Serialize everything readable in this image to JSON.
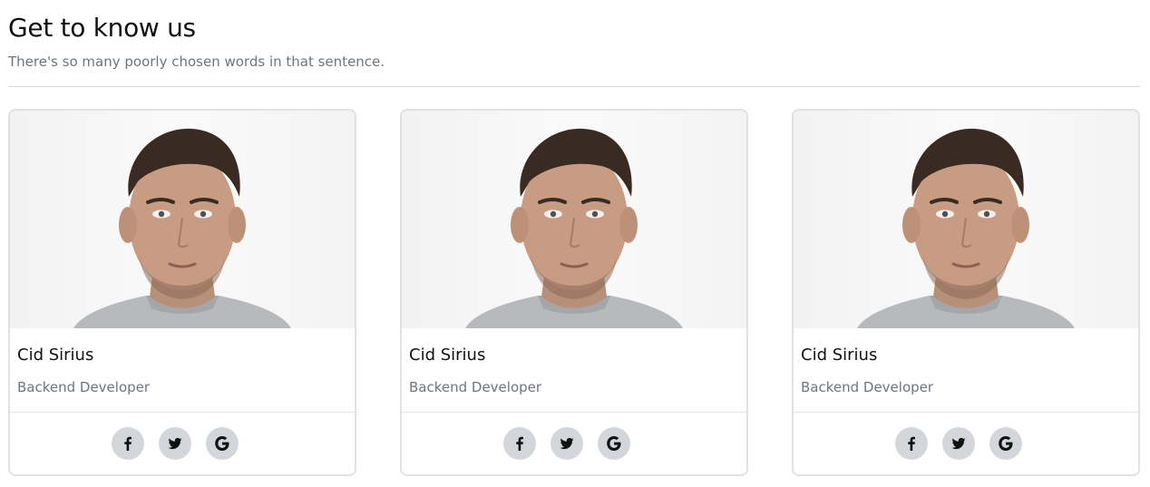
{
  "header": {
    "title": "Get to know us",
    "subtitle": "There's so many poorly chosen words in that sentence."
  },
  "team": [
    {
      "name": "Cid Sirius",
      "role": "Backend Developer",
      "photo": "portrait-photo",
      "socials": [
        "facebook-icon",
        "twitter-icon",
        "google-icon"
      ]
    },
    {
      "name": "Cid Sirius",
      "role": "Backend Developer",
      "photo": "portrait-photo",
      "socials": [
        "facebook-icon",
        "twitter-icon",
        "google-icon"
      ]
    },
    {
      "name": "Cid Sirius",
      "role": "Backend Developer",
      "photo": "portrait-photo",
      "socials": [
        "facebook-icon",
        "twitter-icon",
        "google-icon"
      ]
    }
  ],
  "colors": {
    "social_button_bg": "#d3d6da",
    "card_border": "#e0e3e6",
    "muted_text": "#6c757d"
  }
}
